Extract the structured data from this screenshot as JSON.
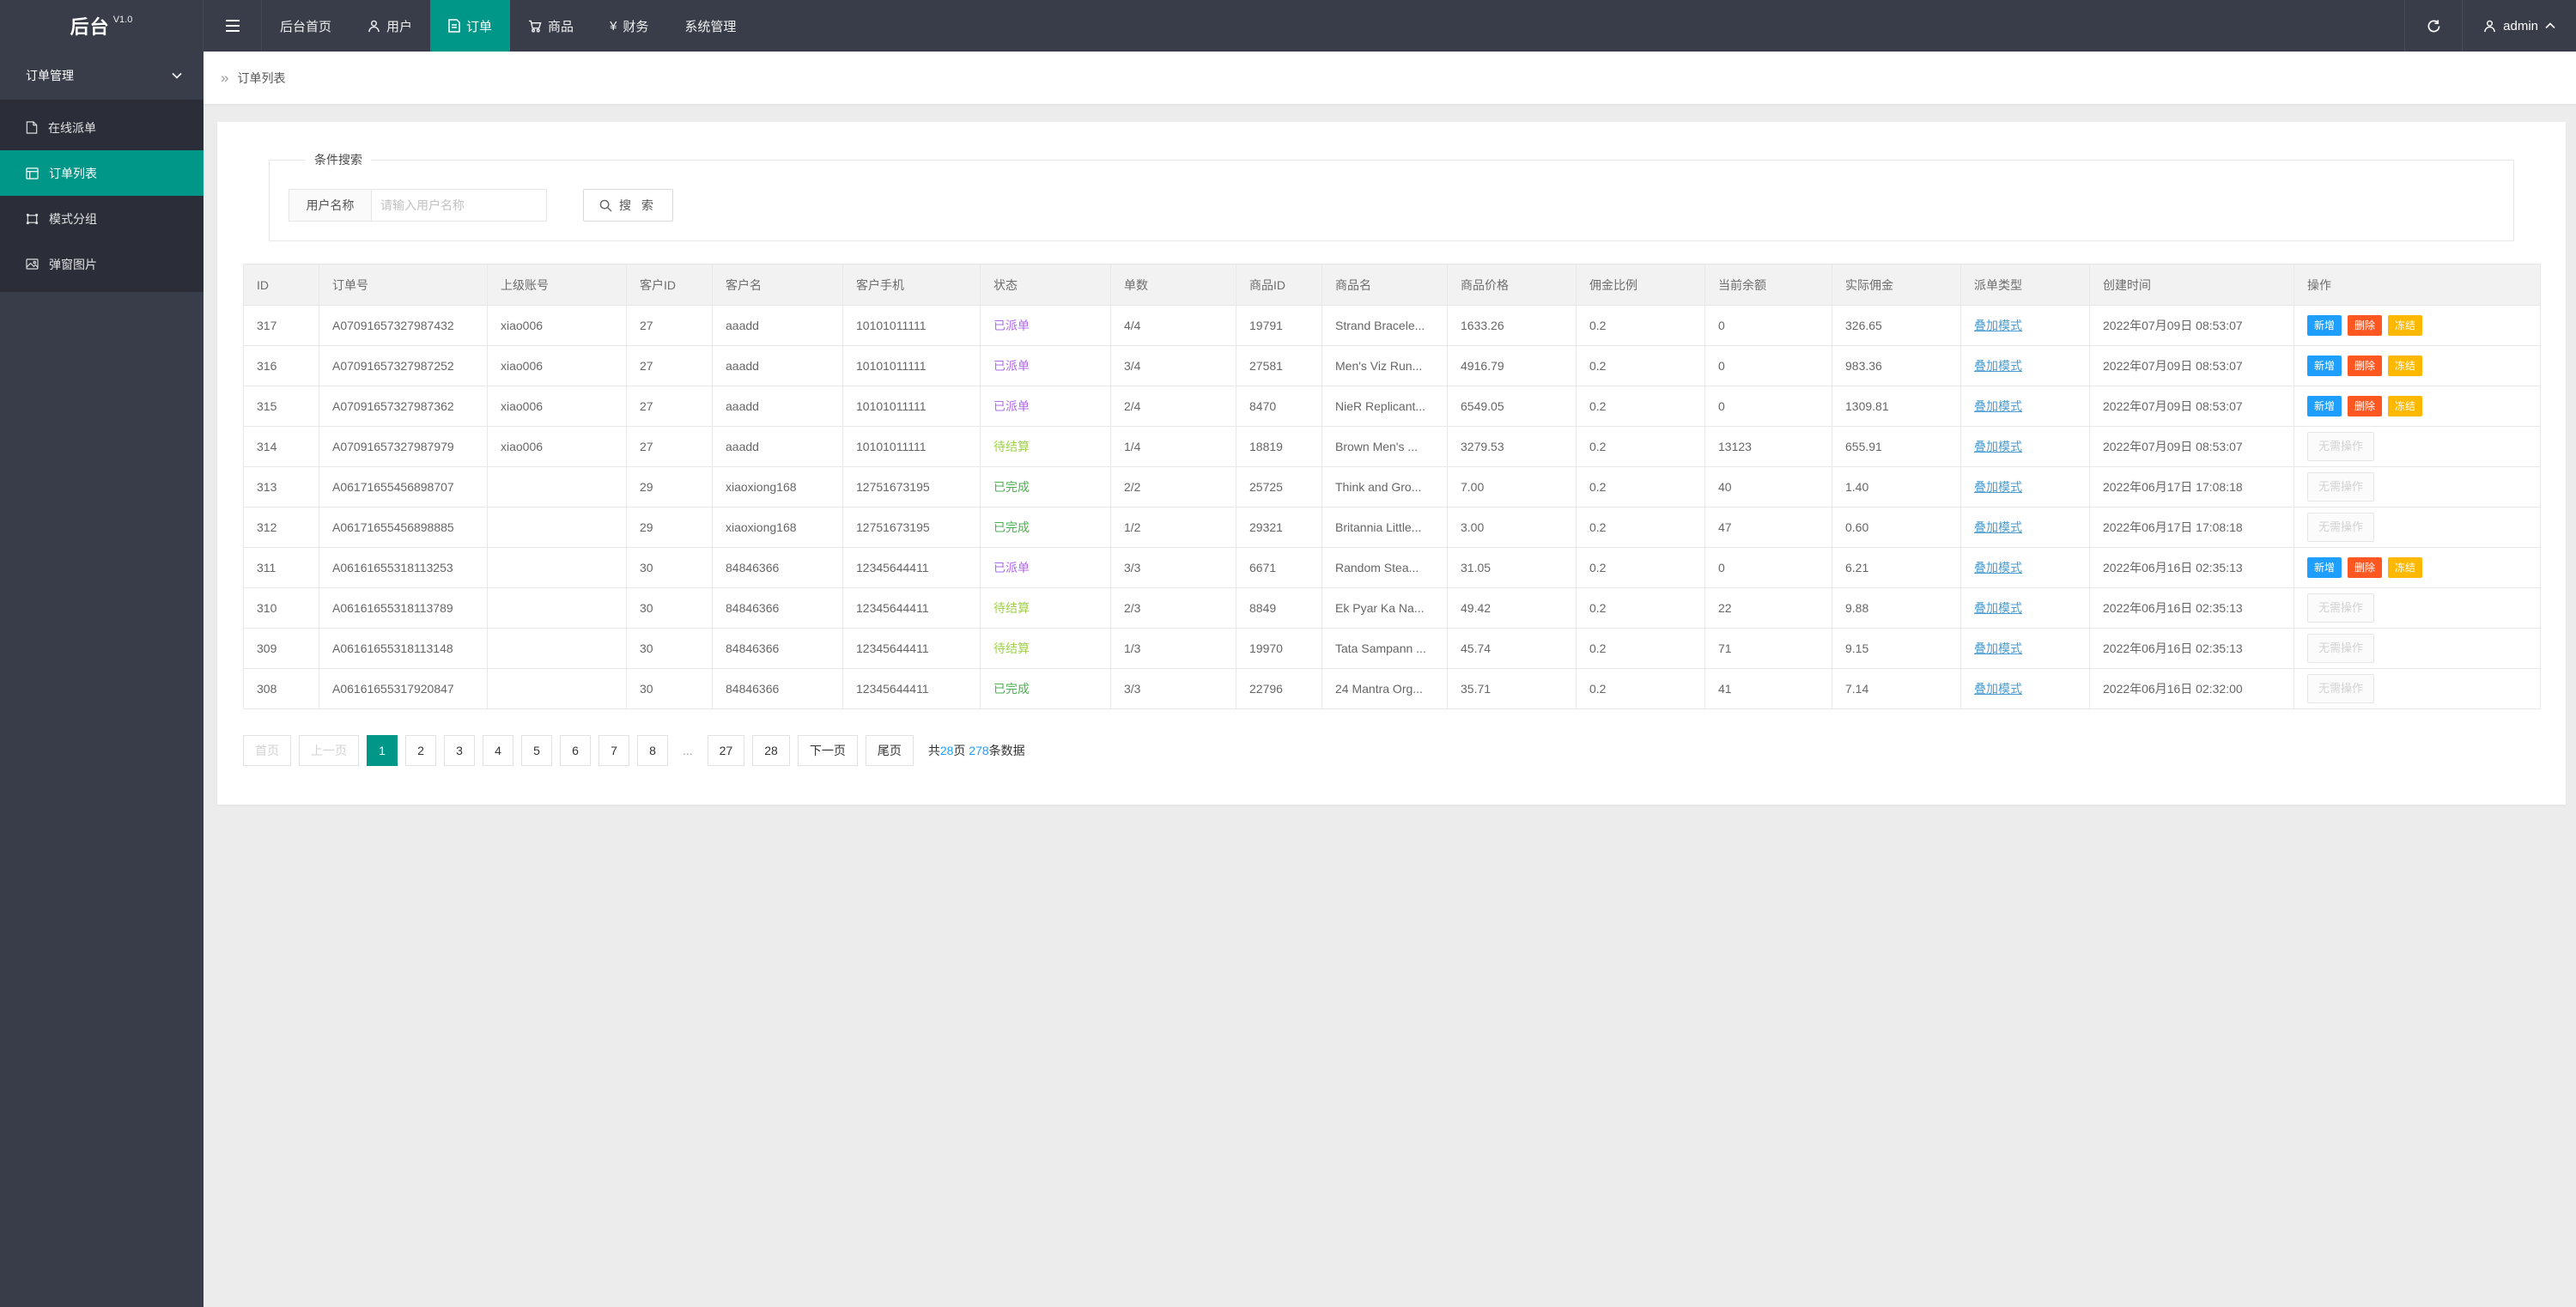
{
  "colors": {
    "accent": "#009688",
    "nav_bg": "#393D49",
    "submenu_bg": "#2b2e38",
    "status_dispatched": "#b06be8",
    "status_pending": "#a0d04a",
    "status_done": "#4caf50",
    "link": "#4a9cd2",
    "btn_add": "#1E9FFF",
    "btn_delete": "#FF5722",
    "btn_freeze": "#FFB800",
    "count_highlight": "#1E9FFF"
  },
  "app": {
    "title": "后台",
    "version": "V1.0"
  },
  "topnav": {
    "items": [
      {
        "label": "后台首页",
        "icon": null,
        "active": false
      },
      {
        "label": "用户",
        "icon": "user",
        "active": false
      },
      {
        "label": "订单",
        "icon": "order",
        "active": true
      },
      {
        "label": "商品",
        "icon": "cart",
        "active": false
      },
      {
        "label": "财务",
        "icon": "yen",
        "active": false
      },
      {
        "label": "系统管理",
        "icon": null,
        "active": false
      }
    ],
    "user": "admin"
  },
  "sidebar": {
    "group": "订单管理",
    "items": [
      {
        "label": "在线派单",
        "icon": "file",
        "active": false
      },
      {
        "label": "订单列表",
        "icon": "list",
        "active": true
      },
      {
        "label": "模式分组",
        "icon": "group",
        "active": false
      },
      {
        "label": "弹窗图片",
        "icon": "image",
        "active": false
      }
    ]
  },
  "breadcrumb": {
    "arrows": "»",
    "current": "订单列表"
  },
  "search": {
    "legend": "条件搜索",
    "label": "用户名称",
    "placeholder": "请输入用户名称",
    "button": "搜 索"
  },
  "actions": {
    "add": "新增",
    "delete": "删除",
    "freeze": "冻结",
    "none": "无需操作"
  },
  "table": {
    "columns": [
      "ID",
      "订单号",
      "上级账号",
      "客户ID",
      "客户名",
      "客户手机",
      "状态",
      "单数",
      "商品ID",
      "商品名",
      "商品价格",
      "佣金比例",
      "当前余额",
      "实际佣金",
      "派单类型",
      "创建时间",
      "操作"
    ],
    "rows": [
      {
        "id": "317",
        "order_no": "A07091657327987432",
        "parent": "xiao006",
        "customer_id": "27",
        "customer_name": "aaadd",
        "phone": "10101011111",
        "status": "已派单",
        "status_key": "dispatched",
        "count": "4/4",
        "product_id": "19791",
        "product_name": "Strand Bracele...",
        "price": "1633.26",
        "ratio": "0.2",
        "balance": "0",
        "commission": "326.65",
        "dispatch_type": "叠加模式",
        "created": "2022年07月09日 08:53:07",
        "ops": "buttons"
      },
      {
        "id": "316",
        "order_no": "A07091657327987252",
        "parent": "xiao006",
        "customer_id": "27",
        "customer_name": "aaadd",
        "phone": "10101011111",
        "status": "已派单",
        "status_key": "dispatched",
        "count": "3/4",
        "product_id": "27581",
        "product_name": "Men's Viz Run...",
        "price": "4916.79",
        "ratio": "0.2",
        "balance": "0",
        "commission": "983.36",
        "dispatch_type": "叠加模式",
        "created": "2022年07月09日 08:53:07",
        "ops": "buttons"
      },
      {
        "id": "315",
        "order_no": "A07091657327987362",
        "parent": "xiao006",
        "customer_id": "27",
        "customer_name": "aaadd",
        "phone": "10101011111",
        "status": "已派单",
        "status_key": "dispatched",
        "count": "2/4",
        "product_id": "8470",
        "product_name": "NieR Replicant...",
        "price": "6549.05",
        "ratio": "0.2",
        "balance": "0",
        "commission": "1309.81",
        "dispatch_type": "叠加模式",
        "created": "2022年07月09日 08:53:07",
        "ops": "buttons"
      },
      {
        "id": "314",
        "order_no": "A07091657327987979",
        "parent": "xiao006",
        "customer_id": "27",
        "customer_name": "aaadd",
        "phone": "10101011111",
        "status": "待结算",
        "status_key": "pending",
        "count": "1/4",
        "product_id": "18819",
        "product_name": "Brown Men's ...",
        "price": "3279.53",
        "ratio": "0.2",
        "balance": "13123",
        "commission": "655.91",
        "dispatch_type": "叠加模式",
        "created": "2022年07月09日 08:53:07",
        "ops": "none"
      },
      {
        "id": "313",
        "order_no": "A06171655456898707",
        "parent": "",
        "customer_id": "29",
        "customer_name": "xiaoxiong168",
        "phone": "12751673195",
        "status": "已完成",
        "status_key": "done",
        "count": "2/2",
        "product_id": "25725",
        "product_name": "Think and Gro...",
        "price": "7.00",
        "ratio": "0.2",
        "balance": "40",
        "commission": "1.40",
        "dispatch_type": "叠加模式",
        "created": "2022年06月17日 17:08:18",
        "ops": "none"
      },
      {
        "id": "312",
        "order_no": "A06171655456898885",
        "parent": "",
        "customer_id": "29",
        "customer_name": "xiaoxiong168",
        "phone": "12751673195",
        "status": "已完成",
        "status_key": "done",
        "count": "1/2",
        "product_id": "29321",
        "product_name": "Britannia Little...",
        "price": "3.00",
        "ratio": "0.2",
        "balance": "47",
        "commission": "0.60",
        "dispatch_type": "叠加模式",
        "created": "2022年06月17日 17:08:18",
        "ops": "none"
      },
      {
        "id": "311",
        "order_no": "A06161655318113253",
        "parent": "",
        "customer_id": "30",
        "customer_name": "84846366",
        "phone": "12345644411",
        "status": "已派单",
        "status_key": "dispatched",
        "count": "3/3",
        "product_id": "6671",
        "product_name": "Random Stea...",
        "price": "31.05",
        "ratio": "0.2",
        "balance": "0",
        "commission": "6.21",
        "dispatch_type": "叠加模式",
        "created": "2022年06月16日 02:35:13",
        "ops": "buttons"
      },
      {
        "id": "310",
        "order_no": "A06161655318113789",
        "parent": "",
        "customer_id": "30",
        "customer_name": "84846366",
        "phone": "12345644411",
        "status": "待结算",
        "status_key": "pending",
        "count": "2/3",
        "product_id": "8849",
        "product_name": "Ek Pyar Ka Na...",
        "price": "49.42",
        "ratio": "0.2",
        "balance": "22",
        "commission": "9.88",
        "dispatch_type": "叠加模式",
        "created": "2022年06月16日 02:35:13",
        "ops": "none"
      },
      {
        "id": "309",
        "order_no": "A06161655318113148",
        "parent": "",
        "customer_id": "30",
        "customer_name": "84846366",
        "phone": "12345644411",
        "status": "待结算",
        "status_key": "pending",
        "count": "1/3",
        "product_id": "19970",
        "product_name": "Tata Sampann ...",
        "price": "45.74",
        "ratio": "0.2",
        "balance": "71",
        "commission": "9.15",
        "dispatch_type": "叠加模式",
        "created": "2022年06月16日 02:35:13",
        "ops": "none"
      },
      {
        "id": "308",
        "order_no": "A06161655317920847",
        "parent": "",
        "customer_id": "30",
        "customer_name": "84846366",
        "phone": "12345644411",
        "status": "已完成",
        "status_key": "done",
        "count": "3/3",
        "product_id": "22796",
        "product_name": "24 Mantra Org...",
        "price": "35.71",
        "ratio": "0.2",
        "balance": "41",
        "commission": "7.14",
        "dispatch_type": "叠加模式",
        "created": "2022年06月16日 02:32:00",
        "ops": "none"
      }
    ]
  },
  "pagination": {
    "first": "首页",
    "prev": "上一页",
    "pages": [
      "1",
      "2",
      "3",
      "4",
      "5",
      "6",
      "7",
      "8",
      "...",
      "27",
      "28"
    ],
    "active": "1",
    "next": "下一页",
    "last": "尾页",
    "summary": {
      "prefix": "共",
      "total_pages": "28",
      "mid": "页 ",
      "total_records": "278",
      "suffix": "条数据"
    }
  }
}
